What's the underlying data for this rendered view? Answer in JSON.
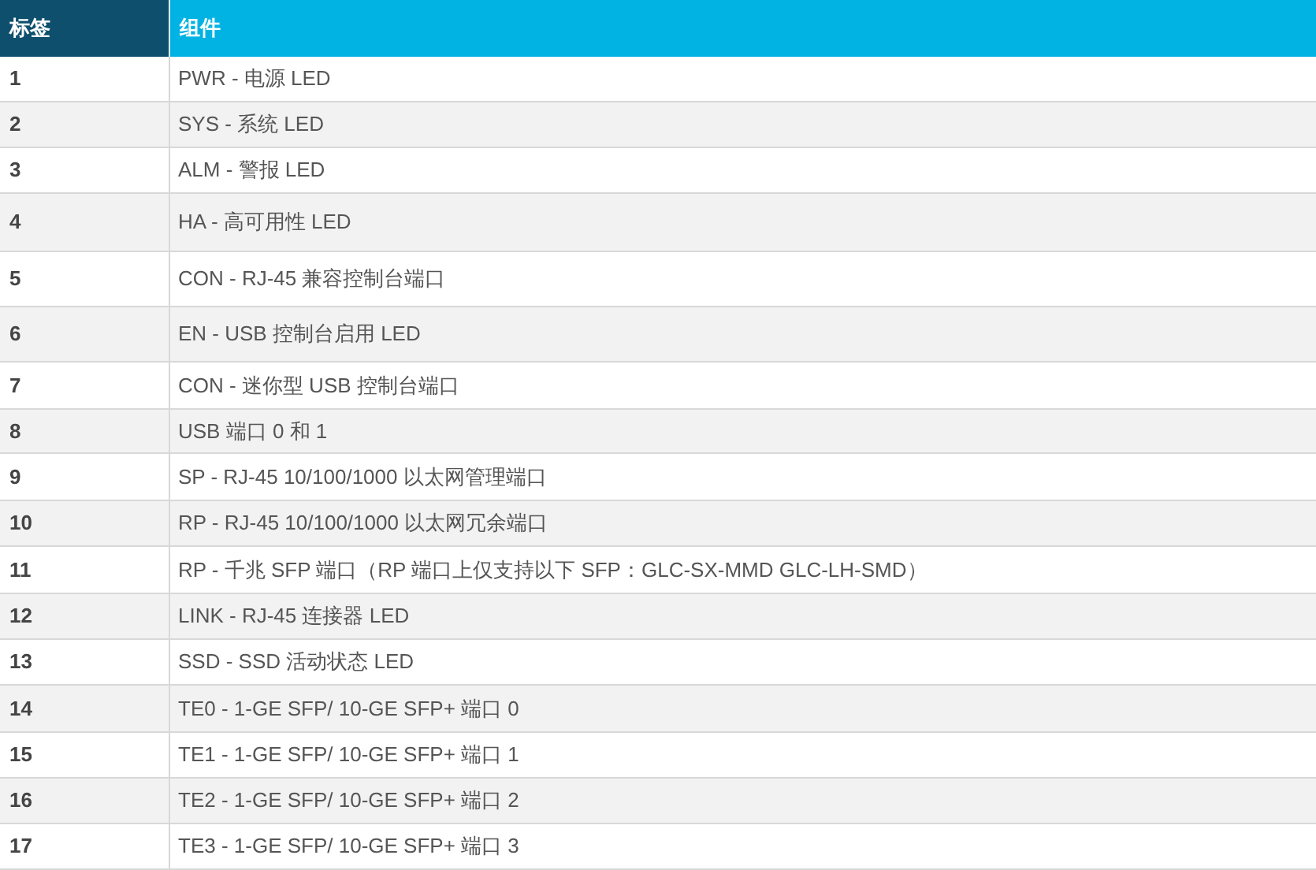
{
  "table": {
    "columns": [
      "标签",
      "组件"
    ],
    "rows": [
      [
        "1",
        "PWR - 电源 LED"
      ],
      [
        "2",
        "SYS - 系统 LED"
      ],
      [
        "3",
        "ALM - 警报 LED"
      ],
      [
        "4",
        "HA - 高可用性 LED"
      ],
      [
        "5",
        "CON - RJ-45 兼容控制台端口"
      ],
      [
        "6",
        "EN - USB 控制台启用 LED"
      ],
      [
        "7",
        "CON - 迷你型 USB 控制台端口"
      ],
      [
        "8",
        "USB 端口 0 和 1"
      ],
      [
        "9",
        "SP - RJ-45 10/100/1000 以太网管理端口"
      ],
      [
        "10",
        "RP - RJ-45 10/100/1000 以太网冗余端口"
      ],
      [
        "11",
        "RP - 千兆 SFP 端口（RP 端口上仅支持以下 SFP：GLC-SX-MMD GLC-LH-SMD）"
      ],
      [
        "12",
        "LINK - RJ-45 连接器 LED"
      ],
      [
        "13",
        "SSD - SSD 活动状态 LED"
      ],
      [
        "14",
        "TE0 - 1-GE SFP/ 10-GE SFP+ 端口 0"
      ],
      [
        "15",
        "TE1 - 1-GE SFP/ 10-GE SFP+ 端口 1"
      ],
      [
        "16",
        "TE2 - 1-GE SFP/ 10-GE SFP+ 端口 2"
      ],
      [
        "17",
        "TE3 - 1-GE SFP/ 10-GE SFP+ 端口 3"
      ]
    ]
  }
}
